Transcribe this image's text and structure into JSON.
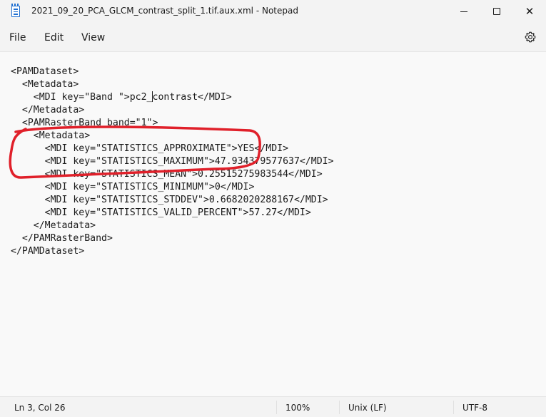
{
  "window": {
    "title": "2021_09_20_PCA_GLCM_contrast_split_1.tif.aux.xml - Notepad",
    "minimize_glyph": "—",
    "maximize_glyph": "☐",
    "close_glyph": "✕"
  },
  "menu": {
    "file": "File",
    "edit": "Edit",
    "view": "View",
    "settings_icon": "gear-icon"
  },
  "editor": {
    "lines": [
      "<PAMDataset>",
      "  <Metadata>",
      "    <MDI key=\"Band \">pc2_contrast</MDI>",
      "  </Metadata>",
      "  <PAMRasterBand band=\"1\">",
      "    <Metadata>",
      "      <MDI key=\"STATISTICS_APPROXIMATE\">YES</MDI>",
      "      <MDI key=\"STATISTICS_MAXIMUM\">47.934379577637</MDI>",
      "      <MDI key=\"STATISTICS_MEAN\">0.25515275983544</MDI>",
      "      <MDI key=\"STATISTICS_MINIMUM\">0</MDI>",
      "      <MDI key=\"STATISTICS_STDDEV\">0.6682020288167</MDI>",
      "      <MDI key=\"STATISTICS_VALID_PERCENT\">57.27</MDI>",
      "    </Metadata>",
      "  </PAMRasterBand>",
      "</PAMDataset>"
    ],
    "caret_line": 3,
    "caret_col": 26,
    "annotation_color": "#e0202a"
  },
  "status": {
    "position": "Ln 3, Col 26",
    "zoom": "100%",
    "line_ending": "Unix (LF)",
    "encoding": "UTF-8"
  },
  "colors": {
    "chrome": "#f3f3f3",
    "editor_bg": "#f9f9f9",
    "icon_accent": "#1f6fd1"
  }
}
